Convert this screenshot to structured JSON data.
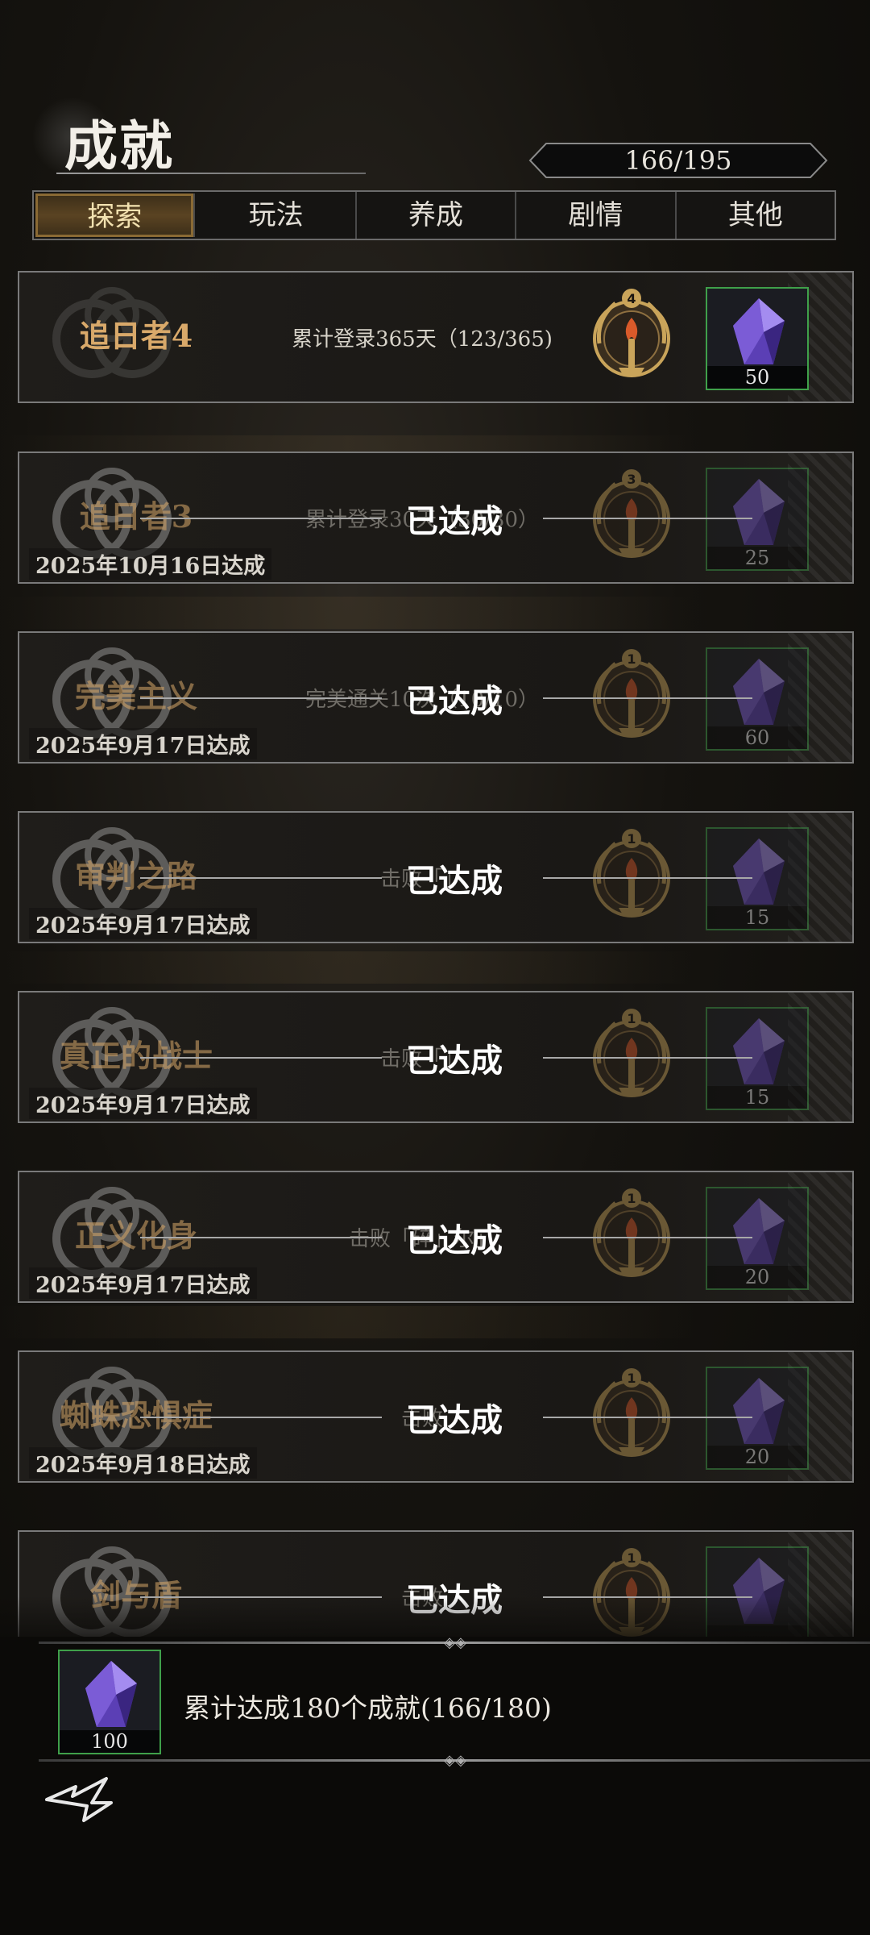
{
  "header": {
    "title": "成就",
    "progress": "166/195"
  },
  "tabs": [
    {
      "label": "探索",
      "active": true
    },
    {
      "label": "玩法",
      "active": false
    },
    {
      "label": "养成",
      "active": false
    },
    {
      "label": "剧情",
      "active": false
    },
    {
      "label": "其他",
      "active": false
    }
  ],
  "achievements": [
    {
      "name": "追日者4",
      "desc": "累计登录365天（123/365)",
      "medal_level": "4",
      "reward_qty": "50",
      "completed": false
    },
    {
      "name": "追日者3",
      "desc": "累计登录30天（30/30）",
      "medal_level": "3",
      "reward_qty": "25",
      "completed": true,
      "date": "2025年10月16日达成",
      "status": "已达成"
    },
    {
      "name": "完美主义",
      "desc": "完美通关10次（10/10）",
      "medal_level": "1",
      "reward_qty": "60",
      "completed": true,
      "date": "2025年9月17日达成",
      "status": "已达成"
    },
    {
      "name": "审判之路",
      "desc": "击败「」",
      "medal_level": "1",
      "reward_qty": "15",
      "completed": true,
      "date": "2025年9月17日达成",
      "status": "已达成"
    },
    {
      "name": "真正的战士",
      "desc": "击败「」",
      "medal_level": "1",
      "reward_qty": "15",
      "completed": true,
      "date": "2025年9月17日达成",
      "status": "已达成"
    },
    {
      "name": "正义化身",
      "desc": "击败「碎」尔」",
      "medal_level": "1",
      "reward_qty": "20",
      "completed": true,
      "date": "2025年9月17日达成",
      "status": "已达成"
    },
    {
      "name": "蜘蛛恐惧症",
      "desc": "击败",
      "medal_level": "1",
      "reward_qty": "20",
      "completed": true,
      "date": "2025年9月18日达成",
      "status": "已达成"
    },
    {
      "name": "剑与盾",
      "desc": "击败",
      "medal_level": "1",
      "reward_qty": "",
      "completed": true,
      "date": "",
      "status": "已达成"
    }
  ],
  "footer": {
    "text": "累计达成180个成就(166/180)",
    "reward_qty": "100"
  },
  "colors": {
    "accent_gold": "#d9a96a",
    "reward_border": "#3fa04a",
    "gem": "#7b5cd6"
  },
  "icons": {
    "reward": "purple-crystal-icon",
    "medal": "torch-laurel-medal-icon",
    "back": "back-arrow-icon"
  }
}
